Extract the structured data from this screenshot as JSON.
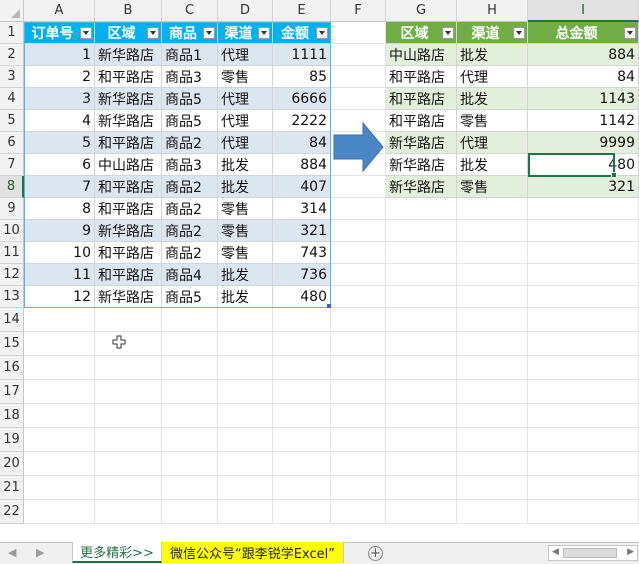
{
  "columns": [
    "A",
    "B",
    "C",
    "D",
    "E",
    "F",
    "G",
    "H",
    "I"
  ],
  "rows": [
    "1",
    "2",
    "3",
    "4",
    "5",
    "6",
    "7",
    "8",
    "9",
    "10",
    "11",
    "12",
    "13",
    "14",
    "15",
    "16",
    "17",
    "18",
    "19",
    "20",
    "21",
    "22"
  ],
  "left_table": {
    "headers": [
      "订单号",
      "区域",
      "商品",
      "渠道",
      "金额"
    ],
    "rows": [
      [
        "1",
        "新华路店",
        "商品1",
        "代理",
        "1111"
      ],
      [
        "2",
        "和平路店",
        "商品3",
        "零售",
        "85"
      ],
      [
        "3",
        "新华路店",
        "商品5",
        "代理",
        "6666"
      ],
      [
        "4",
        "新华路店",
        "商品5",
        "代理",
        "2222"
      ],
      [
        "5",
        "和平路店",
        "商品2",
        "代理",
        "84"
      ],
      [
        "6",
        "中山路店",
        "商品3",
        "批发",
        "884"
      ],
      [
        "7",
        "和平路店",
        "商品2",
        "批发",
        "407"
      ],
      [
        "8",
        "和平路店",
        "商品2",
        "零售",
        "314"
      ],
      [
        "9",
        "新华路店",
        "商品2",
        "零售",
        "321"
      ],
      [
        "10",
        "和平路店",
        "商品2",
        "零售",
        "743"
      ],
      [
        "11",
        "和平路店",
        "商品4",
        "批发",
        "736"
      ],
      [
        "12",
        "新华路店",
        "商品5",
        "批发",
        "480"
      ]
    ]
  },
  "right_table": {
    "headers": [
      "区域",
      "渠道",
      "总金额"
    ],
    "rows": [
      [
        "中山路店",
        "批发",
        "884"
      ],
      [
        "和平路店",
        "代理",
        "84"
      ],
      [
        "和平路店",
        "批发",
        "1143"
      ],
      [
        "和平路店",
        "零售",
        "1142"
      ],
      [
        "新华路店",
        "代理",
        "9999"
      ],
      [
        "新华路店",
        "批发",
        "480"
      ],
      [
        "新华路店",
        "零售",
        "321"
      ]
    ]
  },
  "tabs": {
    "tab1": "更多精彩>>",
    "tab2": "微信公众号“跟李锐学Excel”",
    "add": "+"
  },
  "colors": {
    "blue_header": "#00b0f0",
    "green_header": "#70ad47",
    "arrow": "#4a86c5",
    "tab_yellow": "#ffff00"
  }
}
